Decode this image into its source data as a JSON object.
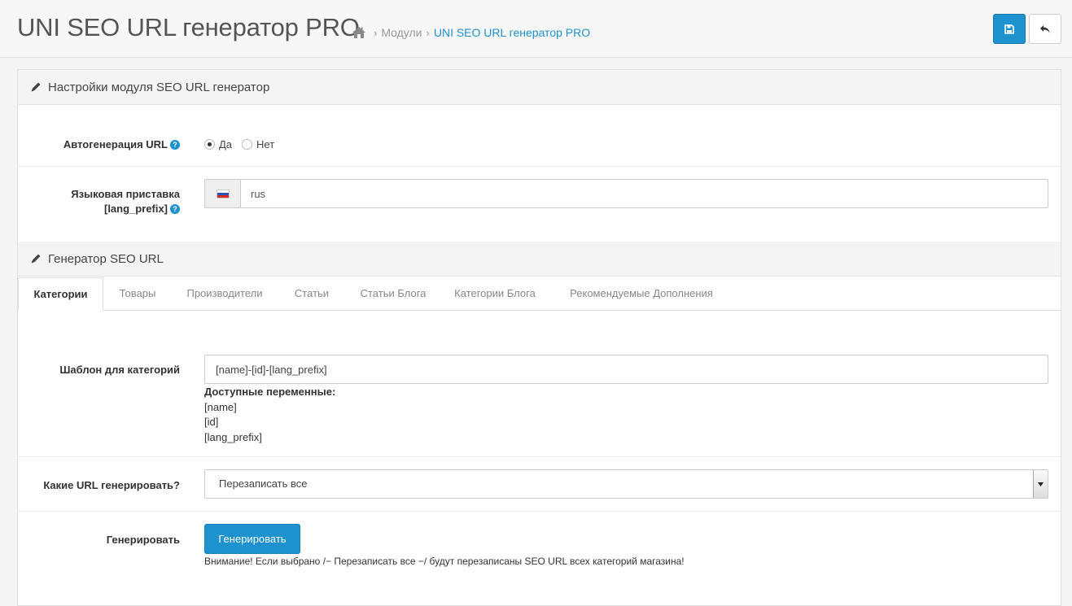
{
  "header": {
    "title": "UNI SEO URL генератор PRO",
    "breadcrumb": {
      "home_icon": "home-icon",
      "separator": "›",
      "items": [
        "Модули",
        "UNI SEO URL генератор PRO"
      ]
    },
    "save_icon": "floppy-disk-icon",
    "back_icon": "reply-icon"
  },
  "settings": {
    "heading": "Настройки модуля SEO URL генератор",
    "autogen": {
      "label": "Автогенерация URL",
      "options": [
        "Да",
        "Нет"
      ],
      "selected": "Да"
    },
    "lang_prefix": {
      "label_line1": "Языковая приставка",
      "label_line2": "[lang_prefix]",
      "value": "rus",
      "flag": "russia-flag"
    }
  },
  "generator": {
    "heading": "Генератор SEO URL",
    "tabs": [
      "Категории",
      "Товары",
      "Производители",
      "Статьи",
      "Статьи Блога",
      "Категории Блога",
      "Рекомендуемые Дополнения"
    ],
    "active_tab": "Категории",
    "template": {
      "label": "Шаблон для категорий",
      "value": "[name]-[id]-[lang_prefix]",
      "vars_title": "Доступные переменные:",
      "vars": [
        "[name]",
        "[id]",
        "[lang_prefix]"
      ]
    },
    "which_urls": {
      "label": "Какие URL генерировать?",
      "selected": "Перезаписать все"
    },
    "generate": {
      "label": "Генерировать",
      "button": "Генерировать",
      "warning": "Внимание! Если выбрано /− Перезаписать все −/ будут перезаписаны SEO URL всех категорий магазина!"
    }
  },
  "colors": {
    "accent": "#1e91cf",
    "heading_bg": "#f4f4f4"
  }
}
